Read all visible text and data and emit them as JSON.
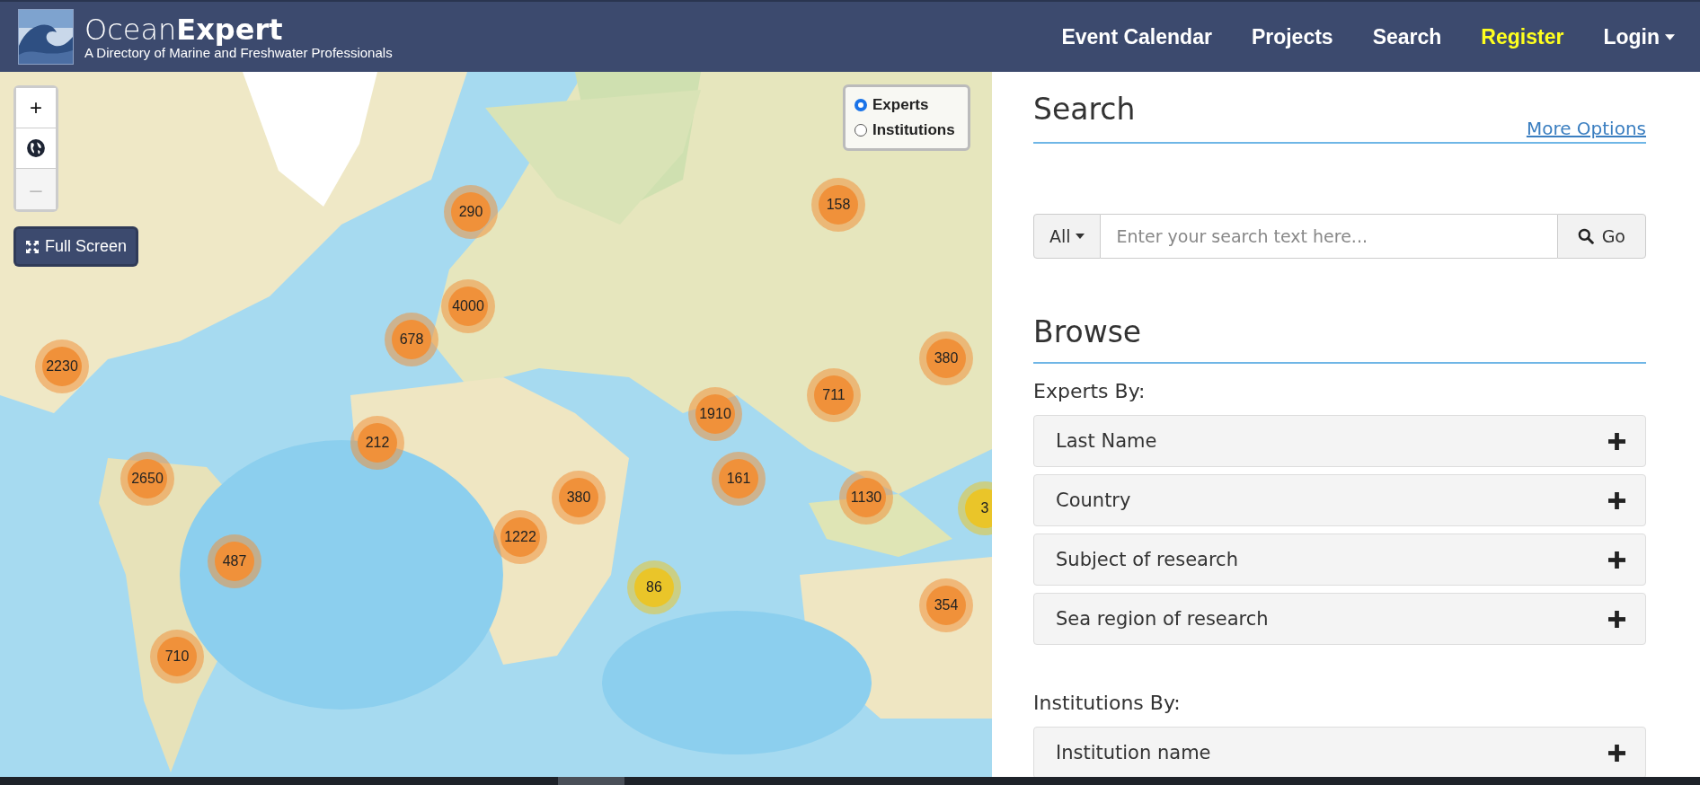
{
  "header": {
    "brand_light": "Ocean",
    "brand_bold": "Expert",
    "tagline": "A Directory of Marine and Freshwater Professionals",
    "nav": [
      {
        "label": "Event Calendar",
        "kind": "link"
      },
      {
        "label": "Projects",
        "kind": "link"
      },
      {
        "label": "Search",
        "kind": "link"
      },
      {
        "label": "Register",
        "kind": "highlight"
      },
      {
        "label": "Login",
        "kind": "dropdown"
      }
    ]
  },
  "map": {
    "zoom_in": "+",
    "zoom_out": "–",
    "zoom_out_disabled": true,
    "full_screen": "Full Screen",
    "layers": [
      {
        "label": "Experts",
        "selected": true
      },
      {
        "label": "Institutions",
        "selected": false
      }
    ],
    "clusters": [
      {
        "count": "290",
        "color": "#f0913a"
      },
      {
        "count": "158",
        "color": "#f0913a"
      },
      {
        "count": "4000",
        "color": "#f0913a"
      },
      {
        "count": "678",
        "color": "#f0913a"
      },
      {
        "count": "2230",
        "color": "#f0913a"
      },
      {
        "count": "380",
        "color": "#f0913a"
      },
      {
        "count": "711",
        "color": "#f0913a"
      },
      {
        "count": "1910",
        "color": "#f0913a"
      },
      {
        "count": "212",
        "color": "#f0913a"
      },
      {
        "count": "2650",
        "color": "#f0913a"
      },
      {
        "count": "161",
        "color": "#f0913a"
      },
      {
        "count": "1130",
        "color": "#f0913a"
      },
      {
        "count": "3",
        "color": "#eac529"
      },
      {
        "count": "380",
        "color": "#f0913a"
      },
      {
        "count": "1222",
        "color": "#f0913a"
      },
      {
        "count": "487",
        "color": "#f0913a"
      },
      {
        "count": "86",
        "color": "#eac529"
      },
      {
        "count": "354",
        "color": "#f0913a"
      },
      {
        "count": "710",
        "color": "#f0913a"
      }
    ]
  },
  "search": {
    "title": "Search",
    "more_options": "More Options",
    "scope": "All",
    "placeholder": "Enter your search text here...",
    "go": "Go"
  },
  "browse": {
    "title": "Browse",
    "groups": [
      {
        "title": "Experts By:",
        "items": [
          {
            "label": "Last Name",
            "expanded": false
          },
          {
            "label": "Country",
            "expanded": false
          },
          {
            "label": "Subject of research",
            "expanded": false
          },
          {
            "label": "Sea region of research",
            "expanded": false
          }
        ]
      },
      {
        "title": "Institutions By:",
        "items": [
          {
            "label": "Institution name",
            "expanded": false
          }
        ]
      }
    ]
  }
}
